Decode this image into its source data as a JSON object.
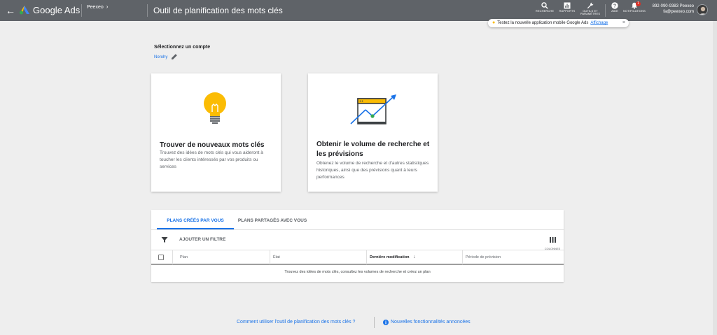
{
  "header": {
    "app_name": "Google Ads",
    "account": "Peexeo",
    "page_title": "Outil de planification des mots clés",
    "nav": {
      "search": "RECHERCHE",
      "reports": "RAPPORTS",
      "tools": "OUTILS ET PARAMÈTRES",
      "help": "AIDE",
      "notifications": "NOTIFICATIONS",
      "notification_count": "1"
    },
    "user_line1": "892-090-9383 Peexeo",
    "user_line2": "fa@peexeo.com"
  },
  "promo": {
    "text": "Testez la nouvelle application mobile Google Ads",
    "link": "Affichage",
    "close": "×"
  },
  "account_select": {
    "title": "Sélectionnez un compte",
    "value": "Norohy"
  },
  "cards": [
    {
      "title": "Trouver de nouveaux mots clés",
      "description": "Trouvez des idées de mots clés qui vous aideront à toucher les clients intéressés par vos produits ou services"
    },
    {
      "title_line1": "Obtenir le volume de recherche et",
      "title_line2": "les prévisions",
      "description": "Obtenez le volume de recherche et d'autres statistiques historiques, ainsi que des prévisions quant à leurs performances"
    }
  ],
  "plans": {
    "tabs": [
      "PLANS CRÉÉS PAR VOUS",
      "PLANS PARTAGÉS AVEC VOUS"
    ],
    "filter_label": "AJOUTER UN FILTRE",
    "columns_label": "COLONNES",
    "columns": [
      "Plan",
      "État",
      "Dernière modification",
      "Période de prévision"
    ],
    "empty_message": "Trouvez des idées de mots clés, consultez les volumes de recherche et créez un plan"
  },
  "footer": {
    "help_link": "Comment utiliser l'outil de planification des mots clés ?",
    "news_link": "Nouvelles fonctionnalités annoncées"
  },
  "colors": {
    "topbar": "#5f6368",
    "accent": "#1a73e8",
    "bulb": "#fbbc04",
    "badge": "#d93025"
  }
}
